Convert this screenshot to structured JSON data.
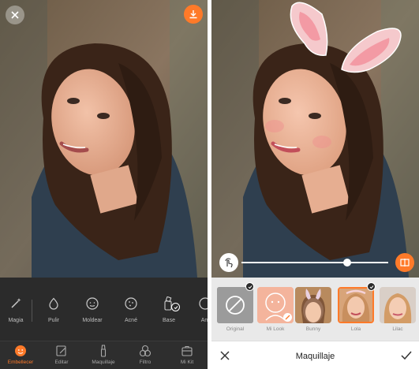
{
  "left": {
    "tools": [
      {
        "icon": "magic-wand-icon",
        "label": "Magia"
      },
      {
        "icon": "drop-icon",
        "label": "Pulir"
      },
      {
        "icon": "face-icon",
        "label": "Moldear"
      },
      {
        "icon": "dots-circle-icon",
        "label": "Acné"
      },
      {
        "icon": "foundation-bottle-icon",
        "label": "Base"
      },
      {
        "icon": "circle-icon",
        "label": "Am"
      }
    ],
    "nav": [
      {
        "icon": "beautify-face-icon",
        "label": "Embellecer",
        "active": true
      },
      {
        "icon": "edit-pencil-icon",
        "label": "Editar",
        "active": false
      },
      {
        "icon": "brush-icon",
        "label": "Maquillaje",
        "active": false
      },
      {
        "icon": "filter-circles-icon",
        "label": "Filtro",
        "active": false
      },
      {
        "icon": "kit-case-icon",
        "label": "Mi Kit",
        "active": false
      }
    ]
  },
  "right": {
    "title": "Maquillaje",
    "slider_level": 0.72,
    "looks": [
      {
        "label": "Original",
        "selected": false
      },
      {
        "label": "Mi Look",
        "selected": false
      },
      {
        "label": "Bunny",
        "selected": false
      },
      {
        "label": "Lola",
        "selected": true
      },
      {
        "label": "Lilac",
        "selected": false
      }
    ]
  },
  "colors": {
    "accent": "#ff7a29",
    "dark_bar": "#2b2b2b",
    "light_bar": "#e9e9e9"
  }
}
